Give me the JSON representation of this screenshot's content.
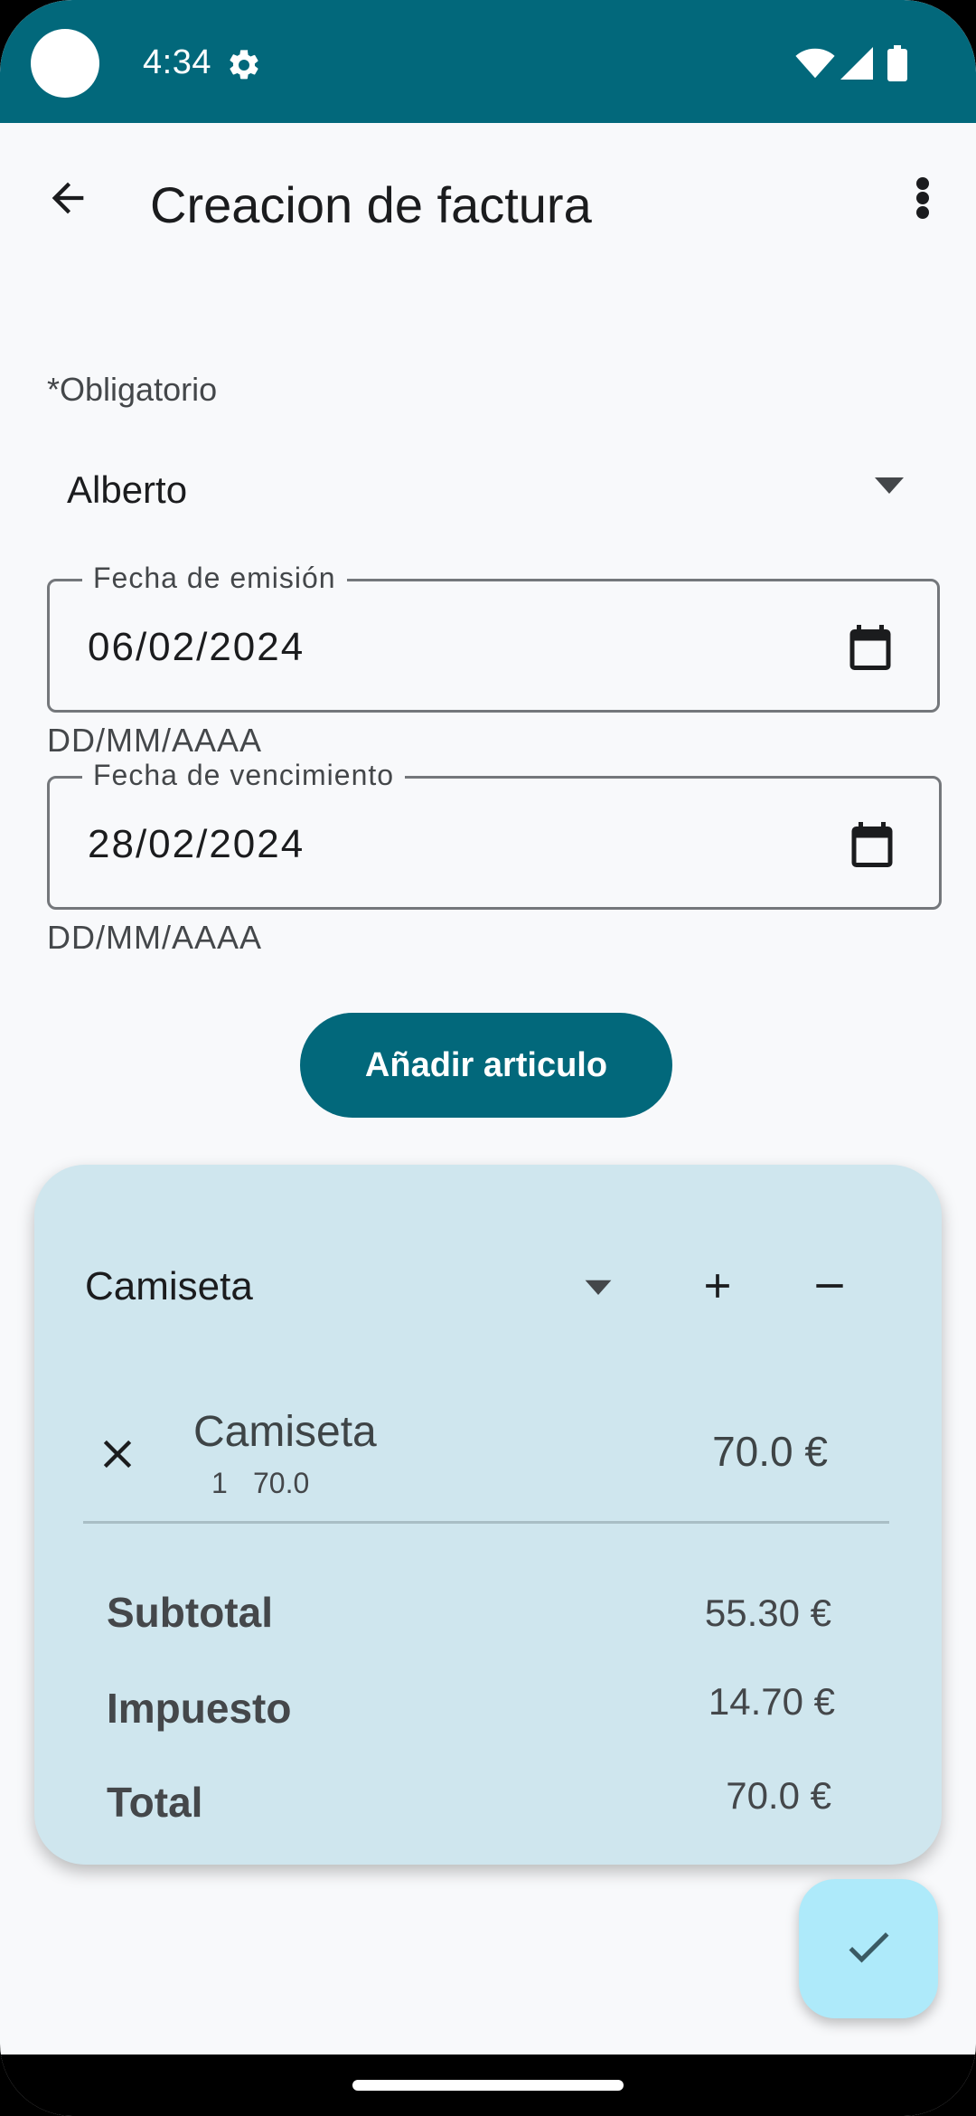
{
  "status_bar": {
    "time": "4:34",
    "icons": [
      "camera-cutout",
      "gear-icon",
      "wifi-icon",
      "signal-icon",
      "battery-icon"
    ]
  },
  "app_bar": {
    "title": "Creacion de factura",
    "icons": [
      "back-arrow-icon",
      "more-vert-icon"
    ]
  },
  "form": {
    "required_label": "*Obligatorio",
    "client": {
      "value": "Alberto"
    },
    "issue_date": {
      "label": "Fecha de emisión",
      "value": "06/02/2024",
      "hint": "DD/MM/AAAA"
    },
    "due_date": {
      "label": "Fecha de vencimiento",
      "value": "28/02/2024",
      "hint": "DD/MM/AAAA"
    },
    "add_item_label": "Añadir articulo"
  },
  "items_card": {
    "selected_article": "Camiseta",
    "lines": [
      {
        "name": "Camiseta",
        "quantity": "1",
        "unit_price": "70.0",
        "total": "70.0 €"
      }
    ],
    "summary": {
      "subtotal_label": "Subtotal",
      "subtotal_value": "55.30 €",
      "tax_label": "Impuesto",
      "tax_value": "14.70 €",
      "total_label": "Total",
      "total_value": "70.0 €"
    }
  },
  "colors": {
    "primary": "#02687b",
    "card_background": "#cfe6ee",
    "fab_background": "#aeeafa",
    "page_background": "#f8f9fb"
  }
}
